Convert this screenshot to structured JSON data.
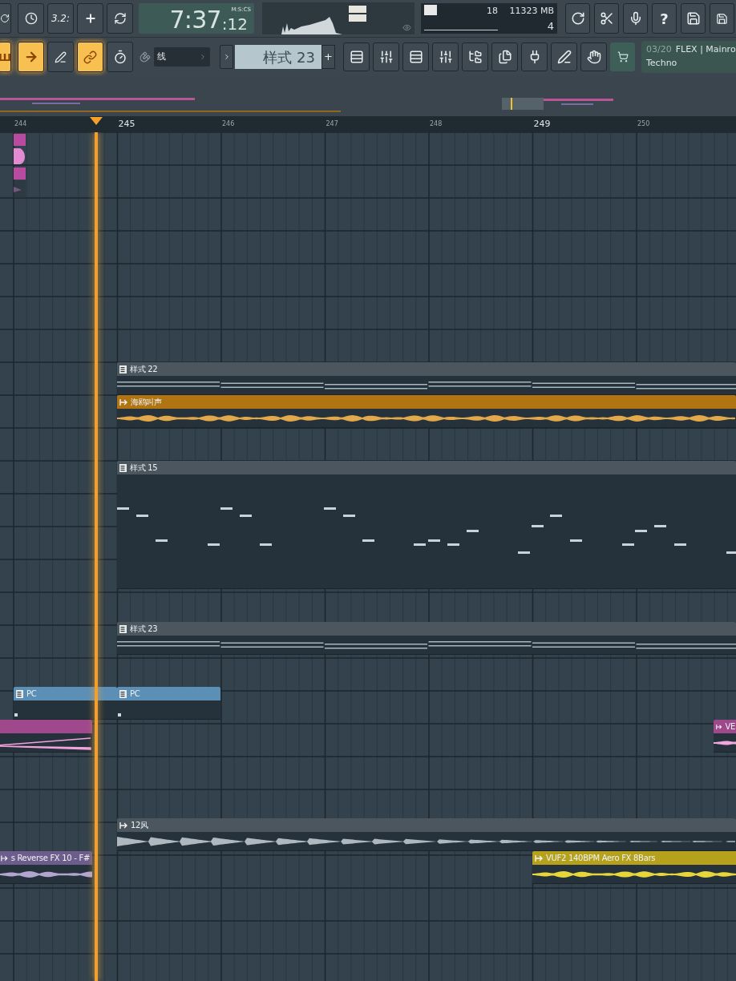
{
  "toolbar": {
    "tempo_button_label": "3.2:",
    "time": {
      "main": "7:37",
      "sub": ":12",
      "format": "M:S:CS"
    },
    "cpu": {
      "polyphony": "18",
      "memory": "11323 MB",
      "cores": "4"
    },
    "help_label": "?"
  },
  "tools": [
    {
      "on": true,
      "label": "Ш"
    },
    {
      "on": true
    },
    {
      "on": false
    },
    {
      "on": true
    },
    {
      "on": false
    }
  ],
  "snap": {
    "value": "线"
  },
  "pattern_selector": {
    "value": "样式 23",
    "add_label": "+"
  },
  "hint_panel": {
    "line_1": "03/20",
    "line_1_title": "FLEX | Mainro",
    "line_2": "Techno"
  },
  "ruler": [
    {
      "label": "244",
      "major": false
    },
    {
      "label": "245",
      "major": true
    },
    {
      "label": "246",
      "major": false
    },
    {
      "label": "247",
      "major": false
    },
    {
      "label": "248",
      "major": false
    },
    {
      "label": "249",
      "major": true
    },
    {
      "label": "250",
      "major": false
    }
  ],
  "clips": [
    {
      "kind": "pattern",
      "name": "样式 22",
      "color": "#4b565f"
    },
    {
      "kind": "audio",
      "name": "海鸥叫声",
      "color": "#b07412"
    },
    {
      "kind": "pattern",
      "name": "样式 15",
      "color": "#4b565f"
    },
    {
      "kind": "pattern",
      "name": "样式 23",
      "color": "#4b565f"
    },
    {
      "kind": "pattern",
      "name": "PC",
      "color": "#5b8fb6"
    },
    {
      "kind": "pattern",
      "name": "PC",
      "color": "#5b8fb6"
    },
    {
      "kind": "automation",
      "color": "#a0488c"
    },
    {
      "kind": "audio",
      "name": "VE",
      "color": "#a0488c"
    },
    {
      "kind": "audio",
      "name": "12风",
      "color": "#4b565f"
    },
    {
      "kind": "audio",
      "name": "s Reverse FX 10 - F#",
      "color": "#6d5d8c"
    },
    {
      "kind": "audio",
      "name": "VUF2 140BPM Aero FX 8Bars",
      "color": "#b5a11c"
    }
  ]
}
